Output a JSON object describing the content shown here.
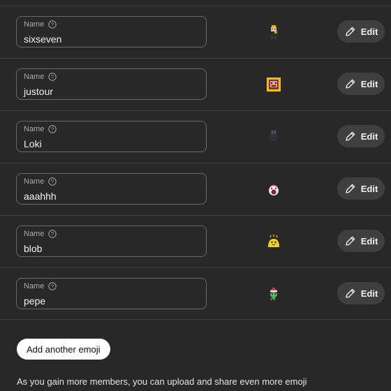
{
  "field_label": "Name",
  "edit_label": "Edit",
  "emojis": [
    {
      "name": "sixseven",
      "icon": "pixel-character-emoji"
    },
    {
      "name": "justour",
      "icon": "yellow-pixel-face-emoji"
    },
    {
      "name": "Loki",
      "icon": "dark-robot-emoji"
    },
    {
      "name": "aaahhh",
      "icon": "screaming-face-emoji"
    },
    {
      "name": "blob",
      "icon": "yellow-blob-emoji"
    },
    {
      "name": "pepe",
      "icon": "green-frog-emoji"
    }
  ],
  "add_button_label": "Add another emoji",
  "footer_text": "As you gain more members, you can upload and share even more emoji",
  "colors": {
    "background": "#282828",
    "button_bg": "#3f3f3f",
    "add_button_bg": "#ffffff"
  }
}
